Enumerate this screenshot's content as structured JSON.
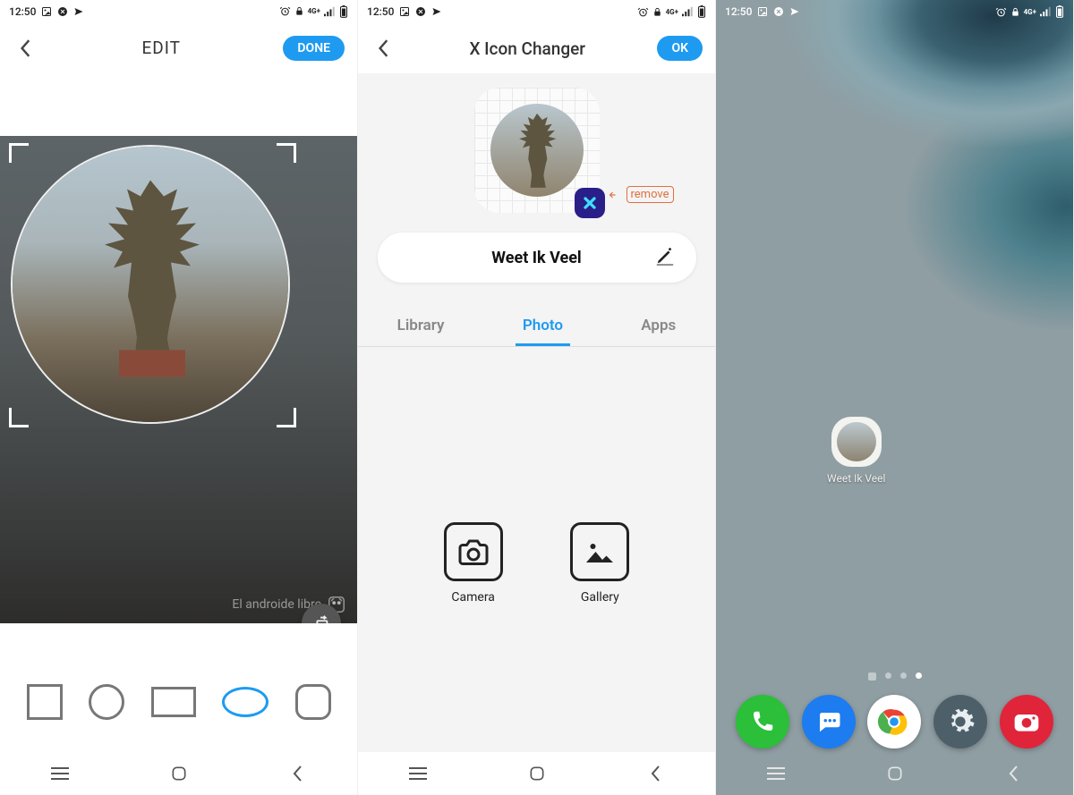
{
  "status": {
    "time": "12:50",
    "icons_left": [
      "image-icon",
      "close-circle-icon",
      "send-icon"
    ],
    "icons_right": [
      "alarm-icon",
      "lock-icon",
      "network-4g-icon",
      "signal-icon",
      "battery-icon"
    ]
  },
  "screen1": {
    "title": "EDIT",
    "done": "DONE",
    "watermark": "El androide libre",
    "shapes": [
      "square",
      "circle",
      "rectangle",
      "oval",
      "squircle"
    ],
    "selected_shape": "oval"
  },
  "screen2": {
    "title": "X Icon Changer",
    "ok": "OK",
    "remove": "remove",
    "app_name": "Weet Ik Veel",
    "tabs": {
      "library": "Library",
      "photo": "Photo",
      "apps": "Apps",
      "active": "photo"
    },
    "sources": {
      "camera": "Camera",
      "gallery": "Gallery"
    }
  },
  "screen3": {
    "shortcut_label": "Weet Ik Veel",
    "dock": [
      "phone",
      "messages",
      "chrome",
      "settings",
      "camera"
    ]
  }
}
